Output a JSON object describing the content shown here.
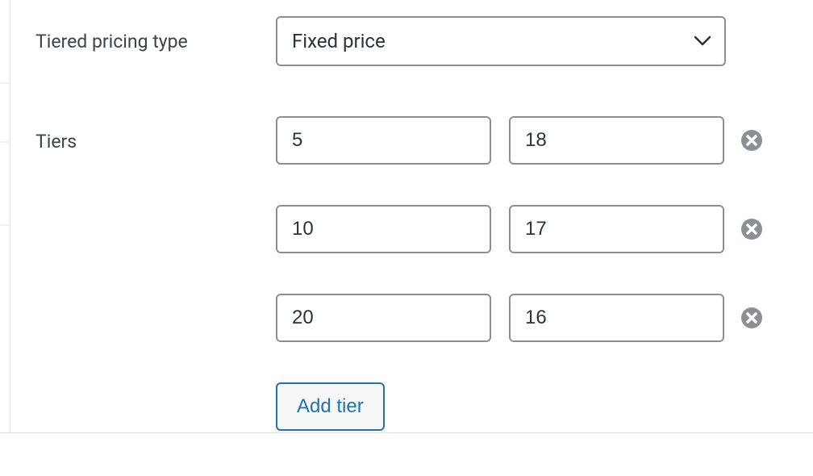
{
  "labels": {
    "pricing_type": "Tiered pricing type",
    "tiers": "Tiers"
  },
  "pricing_type": {
    "selected": "Fixed price"
  },
  "tiers": [
    {
      "qty": "5",
      "price": "18"
    },
    {
      "qty": "10",
      "price": "17"
    },
    {
      "qty": "20",
      "price": "16"
    }
  ],
  "buttons": {
    "add_tier": "Add tier"
  }
}
